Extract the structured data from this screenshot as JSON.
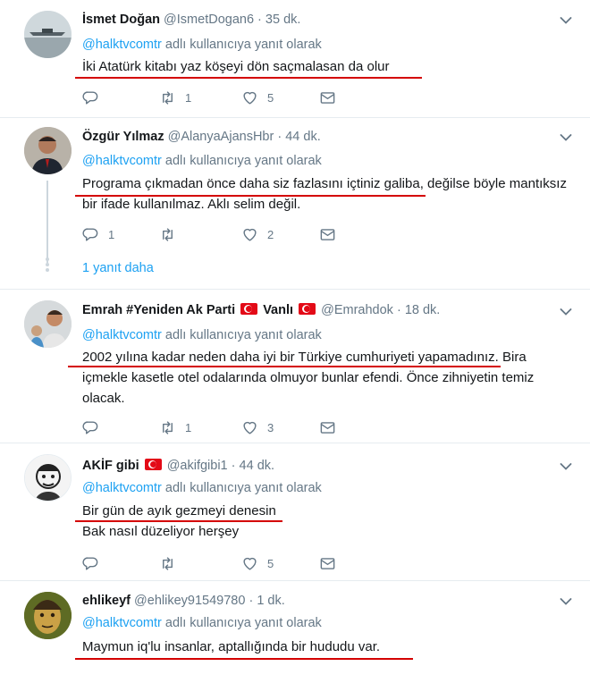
{
  "reply_prefix": "adlı kullanıcıya yanıt olarak",
  "reply_mention": "@halktvcomtr",
  "thread_more": "1 yanıt daha",
  "tweets": [
    {
      "name": "İsmet Doğan",
      "handle": "@IsmetDogan6",
      "time": "35 dk.",
      "lines": [
        "İki Atatürk kitabı yaz köşeyi dön saçmalasan da olur"
      ],
      "reply_count": "",
      "retweet_count": "1",
      "like_count": "5"
    },
    {
      "name": "Özgür Yılmaz",
      "handle": "@AlanyaAjansHbr",
      "time": "44 dk.",
      "lines": [
        "Programa çıkmadan önce daha siz fazlasını içtiniz galiba, değilse böyle mantıksız",
        "bir ifade kullanılmaz. Aklı selim değil."
      ],
      "reply_count": "1",
      "retweet_count": "",
      "like_count": "2"
    },
    {
      "name": "Emrah #Yeniden Ak Parti",
      "name_suffix": "Vanlı",
      "handle": "@Emrahdok",
      "time": "18 dk.",
      "lines": [
        "2002 yılına kadar neden daha iyi bir Türkiye cumhuriyeti yapamadınız. Bira",
        "içmekle kasetle otel odalarında olmuyor bunlar efendi. Önce zihniyetin temiz",
        "olacak."
      ],
      "reply_count": "",
      "retweet_count": "1",
      "like_count": "3"
    },
    {
      "name": "AKİF gibi",
      "handle": "@akifgibi1",
      "time": "44 dk.",
      "lines": [
        "Bir gün de ayık gezmeyi denesin",
        "Bak nasıl düzeliyor herşey"
      ],
      "reply_count": "",
      "retweet_count": "",
      "like_count": "5"
    },
    {
      "name": "ehlikeyf",
      "handle": "@ehlikey91549780",
      "time": "1 dk.",
      "lines": [
        "Maymun iq'lu insanlar, aptallığında bir hududu var."
      ]
    }
  ],
  "icons": {
    "reply": "reply-icon",
    "retweet": "retweet-icon",
    "like": "heart-icon",
    "dm": "envelope-icon",
    "menu": "chevron-down-icon"
  },
  "colors": {
    "link": "#1da1f2",
    "muted": "#657786",
    "annotation": "#d40000",
    "flag": "#e30a17"
  }
}
